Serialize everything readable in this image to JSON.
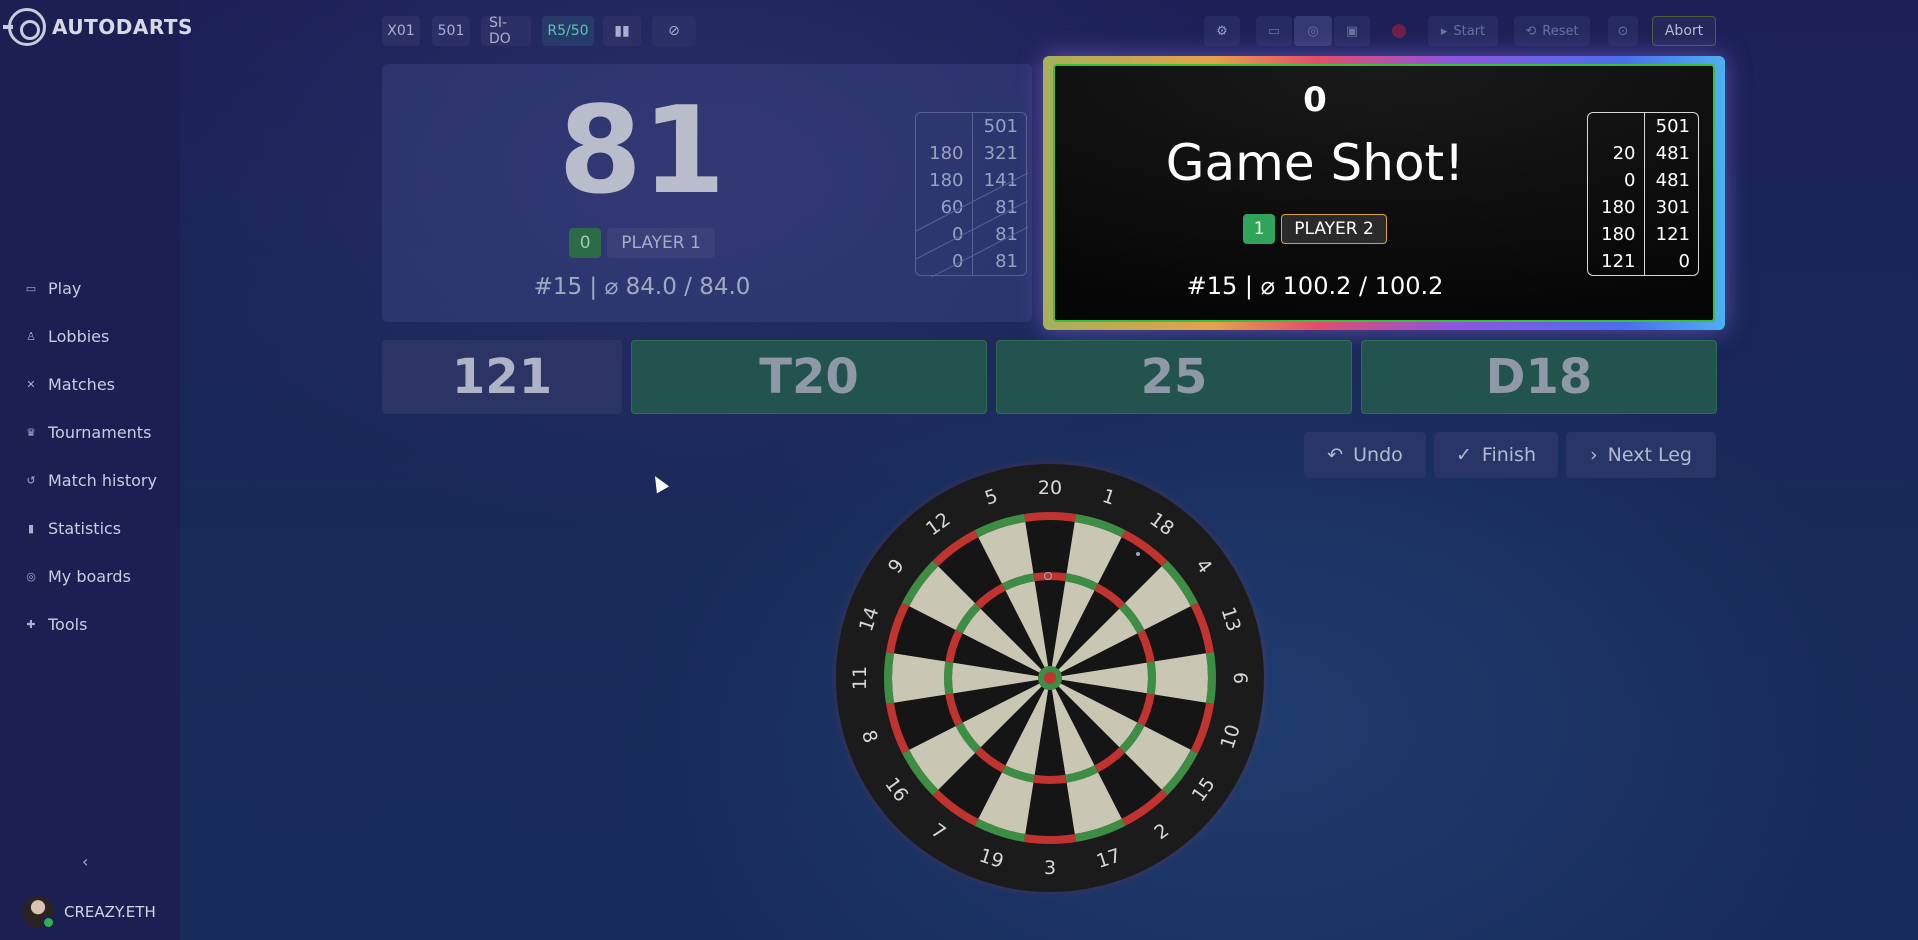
{
  "app": {
    "title": "AUTODARTS"
  },
  "sidebar": {
    "items": [
      {
        "label": "Play",
        "icon": "gamepad-icon"
      },
      {
        "label": "Lobbies",
        "icon": "users-icon"
      },
      {
        "label": "Matches",
        "icon": "swords-icon"
      },
      {
        "label": "Tournaments",
        "icon": "trophy-icon"
      },
      {
        "label": "Match history",
        "icon": "history-icon"
      },
      {
        "label": "Statistics",
        "icon": "bar-chart-icon"
      },
      {
        "label": "My boards",
        "icon": "target-icon"
      },
      {
        "label": "Tools",
        "icon": "puzzle-icon"
      }
    ],
    "collapse_label": "‹",
    "user": {
      "name": "CREAZY.ETH"
    }
  },
  "toolbar": {
    "tags": [
      "X01",
      "501",
      "SI-DO",
      "R5/50"
    ],
    "start_label": "Start",
    "reset_label": "Reset",
    "abort_label": "Abort"
  },
  "player1": {
    "score": "81",
    "legs": "0",
    "name": "PLAYER 1",
    "stats": "#15 | ⌀ 84.0 / 84.0",
    "history": [
      [
        "",
        "501"
      ],
      [
        "180",
        "321"
      ],
      [
        "180",
        "141"
      ],
      [
        "60",
        "81"
      ],
      [
        "0",
        "81"
      ],
      [
        "0",
        "81"
      ]
    ]
  },
  "player2": {
    "score": "0",
    "message": "Game Shot!",
    "legs": "1",
    "name": "PLAYER 2",
    "stats": "#15 | ⌀ 100.2 / 100.2",
    "history": [
      [
        "",
        "501"
      ],
      [
        "20",
        "481"
      ],
      [
        "0",
        "481"
      ],
      [
        "180",
        "301"
      ],
      [
        "180",
        "121"
      ],
      [
        "121",
        "0"
      ]
    ]
  },
  "turn": {
    "total": "121",
    "darts": [
      "T20",
      "25",
      "D18"
    ]
  },
  "actions": {
    "undo": "Undo",
    "finish": "Finish",
    "next_leg": "Next Leg"
  },
  "dartboard": {
    "numbers": [
      "20",
      "1",
      "18",
      "4",
      "13",
      "6",
      "10",
      "15",
      "2",
      "17",
      "3",
      "19",
      "7",
      "16",
      "8",
      "11",
      "14",
      "9",
      "12",
      "5"
    ]
  },
  "colors": {
    "accent_green": "#2fa45a",
    "board_red": "#c0332e",
    "board_green": "#3d8d44",
    "board_cream": "#c9c6b4"
  }
}
